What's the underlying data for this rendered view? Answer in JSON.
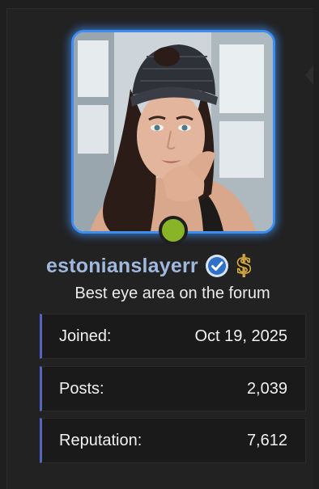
{
  "profile": {
    "username": "estonianslayerr",
    "tagline": "Best eye area on the forum",
    "online_status_color": "#8ab427",
    "avatar_border_color": "#3d8df0",
    "badges": [
      "verified-check-icon",
      "dollar-sign-icon"
    ]
  },
  "stats": {
    "joined": {
      "label": "Joined:",
      "value": "Oct 19, 2025"
    },
    "posts": {
      "label": "Posts:",
      "value": "2,039"
    },
    "reputation": {
      "label": "Reputation:",
      "value": "7,612"
    }
  },
  "colors": {
    "username": "#9fb8dd",
    "stat_accent": "#5563c2",
    "background": "#1f1f20"
  }
}
